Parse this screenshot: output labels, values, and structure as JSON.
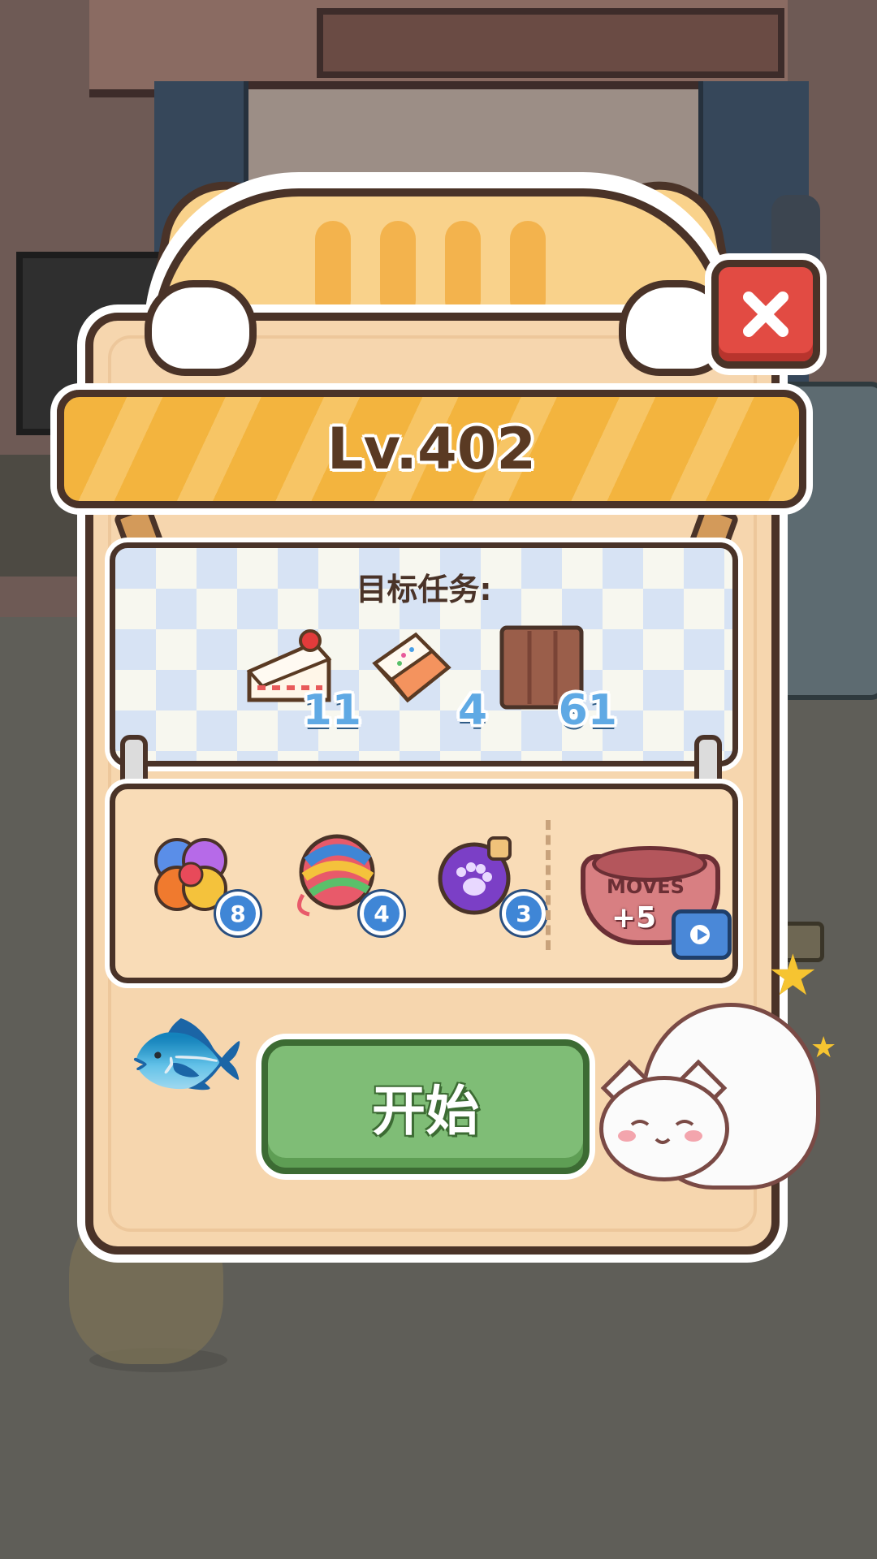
{
  "level": {
    "title": "Lv.402"
  },
  "targets": {
    "title": "目标任务:",
    "items": [
      {
        "icon": "cake-slice-icon",
        "count": "11"
      },
      {
        "icon": "sprinkle-cake-icon",
        "count": "4"
      },
      {
        "icon": "chocolate-block-icon",
        "count": "61"
      }
    ]
  },
  "boosters": [
    {
      "icon": "rainbow-clover-icon",
      "count": "8"
    },
    {
      "icon": "yarn-ball-icon",
      "count": "4"
    },
    {
      "icon": "paw-bomb-icon",
      "count": "3"
    }
  ],
  "moves_offer": {
    "label": "MOVES",
    "bonus": "+5",
    "icon": "video-ad-icon"
  },
  "start_button": {
    "label": "开始"
  },
  "colors": {
    "ribbon": "#f3b43e",
    "panel": "#f6d6ae",
    "start": "#7fbd76",
    "close": "#e24b43",
    "badge": "#3f86d6"
  }
}
